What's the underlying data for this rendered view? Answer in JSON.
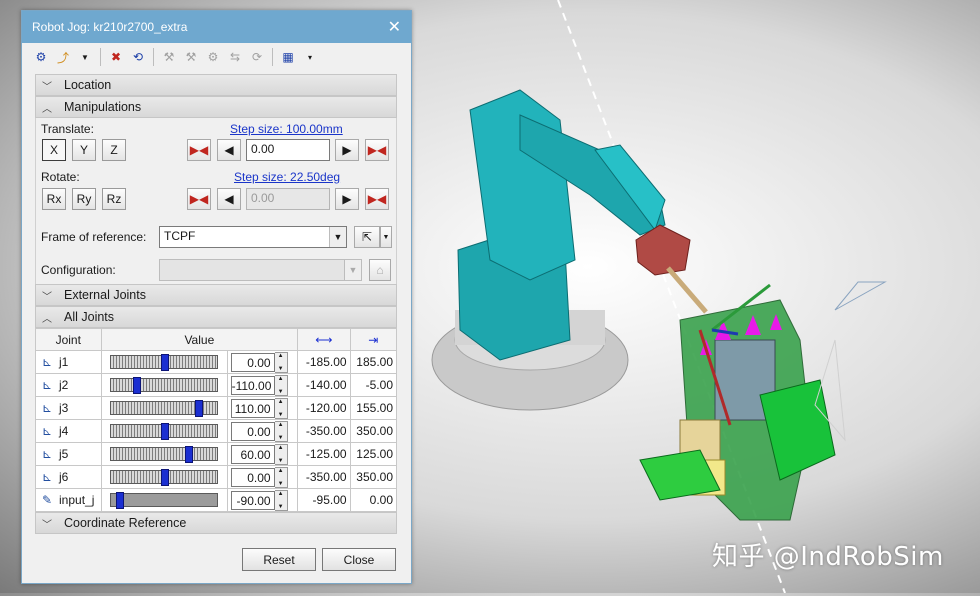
{
  "window": {
    "title": "Robot Jog: kr210r2700_extra"
  },
  "toolbar": {
    "icons": [
      "tool-icon",
      "axis-icon",
      "dropdown-icon",
      "reset-red-icon",
      "teach-icon",
      "disabled-icon-1",
      "disabled-icon-2",
      "disabled-icon-3",
      "disabled-icon-4",
      "disabled-icon-5",
      "table-icon",
      "more-icon"
    ]
  },
  "sections": {
    "location": "Location",
    "manipulations": "Manipulations",
    "external_joints": "External Joints",
    "all_joints": "All Joints",
    "coordinate_reference": "Coordinate Reference"
  },
  "manipulations": {
    "translate_label": "Translate:",
    "translate_step": "Step size: 100.00mm",
    "translate_buttons": [
      "X",
      "Y",
      "Z"
    ],
    "translate_value": "0.00",
    "rotate_label": "Rotate:",
    "rotate_step": "Step size: 22.50deg",
    "rotate_buttons": [
      "Rx",
      "Ry",
      "Rz"
    ],
    "rotate_value": "0.00",
    "frame_label": "Frame of reference:",
    "frame_value": "TCPF",
    "config_label": "Configuration:",
    "config_value": ""
  },
  "joints": {
    "headers": {
      "joint": "Joint",
      "value": "Value"
    },
    "rows": [
      {
        "name": "j1",
        "value": "0.00",
        "min": "-185.00",
        "max": "185.00",
        "level": 0.5
      },
      {
        "name": "j2",
        "value": "-110.00",
        "min": "-140.00",
        "max": "-5.00",
        "level": 0.22
      },
      {
        "name": "j3",
        "value": "110.00",
        "min": "-120.00",
        "max": "155.00",
        "level": 0.84
      },
      {
        "name": "j4",
        "value": "0.00",
        "min": "-350.00",
        "max": "350.00",
        "level": 0.5
      },
      {
        "name": "j5",
        "value": "60.00",
        "min": "-125.00",
        "max": "125.00",
        "level": 0.74
      },
      {
        "name": "j6",
        "value": "0.00",
        "min": "-350.00",
        "max": "350.00",
        "level": 0.5
      },
      {
        "name": "input_j",
        "value": "-90.00",
        "min": "-95.00",
        "max": "0.00",
        "level": 0.05
      }
    ]
  },
  "buttons": {
    "reset": "Reset",
    "close": "Close"
  },
  "watermark": "知乎 @IndRobSim",
  "colors": {
    "title_bar": "#6fa8cf",
    "robot": "#1ea6ad",
    "slider_thumb": "#1b2fd1"
  }
}
